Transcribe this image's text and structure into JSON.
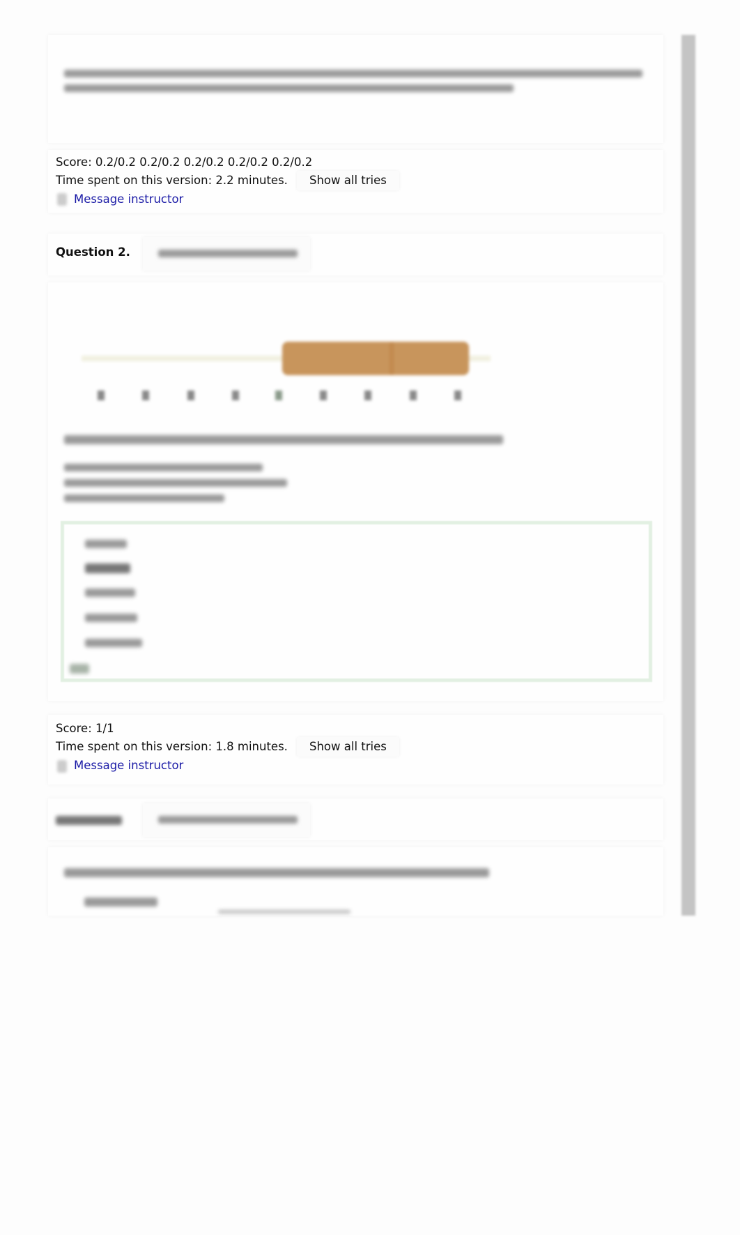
{
  "question1_feedback": {
    "score_label": "Score: 0.2/0.2 0.2/0.2 0.2/0.2 0.2/0.2 0.2/0.2",
    "time_label": "Time spent on this version: 2.2 minutes.",
    "show_all_tries": "Show all tries",
    "message_instructor": "Message instructor"
  },
  "question2": {
    "title": "Question 2.",
    "boxplot_colors": {
      "box": "#c8955c",
      "whisker": "#f1f0e0"
    },
    "answer_border_color": "#d8ecd8",
    "option_count": 5
  },
  "question2_feedback": {
    "score_label": "Score: 1/1",
    "time_label": "Time spent on this version: 1.8 minutes.",
    "show_all_tries": "Show all tries",
    "message_instructor": "Message instructor"
  },
  "icons": {
    "message": "message-icon",
    "pencil": "pencil-icon"
  }
}
